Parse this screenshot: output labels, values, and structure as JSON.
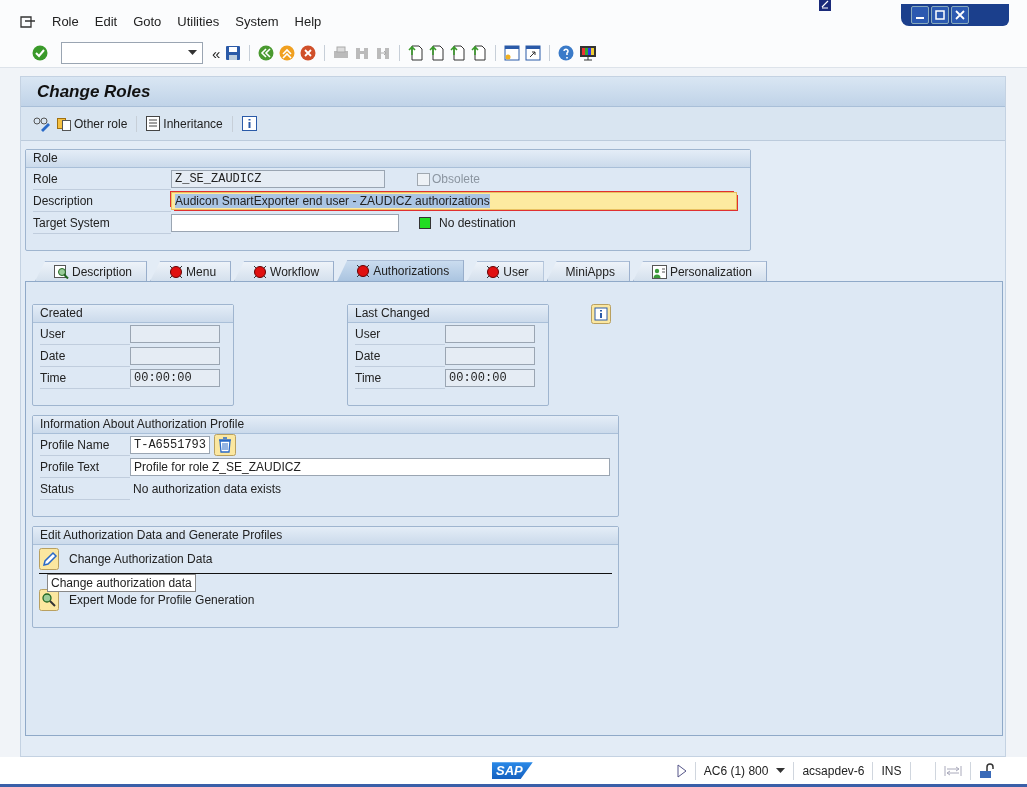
{
  "menu": [
    {
      "label": "Role"
    },
    {
      "label": "Edit"
    },
    {
      "label": "Goto"
    },
    {
      "label": "Utilities"
    },
    {
      "label": "System"
    },
    {
      "label": "Help"
    }
  ],
  "toolbar": {
    "back_glyph": "«"
  },
  "title": "Change Roles",
  "app_toolbar": [
    {
      "label": "Other role",
      "kind": "copy"
    },
    {
      "label": "Inheritance",
      "kind": "list"
    }
  ],
  "role_box": {
    "title": "Role",
    "role_label": "Role",
    "role_value": "Z_SE_ZAUDICZ",
    "obsolete": {
      "label": "Obsolete",
      "checked": false,
      "disabled": true
    },
    "description_label": "Description",
    "description_value": "Audicon SmartExporter end user - ZAUDICZ authorizations",
    "target_label": "Target System",
    "destination": "No destination"
  },
  "tabs": [
    {
      "label": "Description",
      "kind": "magnifier",
      "selected": false
    },
    {
      "label": "Menu",
      "kind": "red",
      "selected": false
    },
    {
      "label": "Workflow",
      "kind": "red",
      "selected": false
    },
    {
      "label": "Authorizations",
      "kind": "red",
      "selected": true
    },
    {
      "label": "User",
      "kind": "red",
      "selected": false
    },
    {
      "label": "MiniApps",
      "kind": "plain",
      "selected": false
    },
    {
      "label": "Personalization",
      "kind": "person",
      "selected": false
    }
  ],
  "created": {
    "title": "Created",
    "rows": [
      {
        "label": "User"
      },
      {
        "label": "Date"
      },
      {
        "label": "Time",
        "value": "00:00:00"
      }
    ]
  },
  "last_changed": {
    "title": "Last Changed",
    "rows": [
      {
        "label": "User"
      },
      {
        "label": "Date"
      },
      {
        "label": "Time",
        "value": "00:00:00"
      }
    ]
  },
  "profile": {
    "title": "Information About Authorization Profile",
    "name_label": "Profile Name",
    "name_value": "T-A6551793",
    "text_label": "Profile Text",
    "text_value": "Profile for role Z_SE_ZAUDICZ",
    "status_label": "Status",
    "status_value": "No authorization data exists"
  },
  "edit": {
    "title": "Edit Authorization Data and Generate Profiles",
    "actions": [
      {
        "label": "Change Authorization Data",
        "kind": "pencil"
      },
      {
        "label": "Expert Mode for Profile Generation",
        "kind": "expert"
      }
    ],
    "tooltip": "Change authorization data"
  },
  "status_bar": {
    "logo": "SAP",
    "system": "AC6 (1) 800",
    "server": "acsapdev-6",
    "mode": "INS"
  }
}
